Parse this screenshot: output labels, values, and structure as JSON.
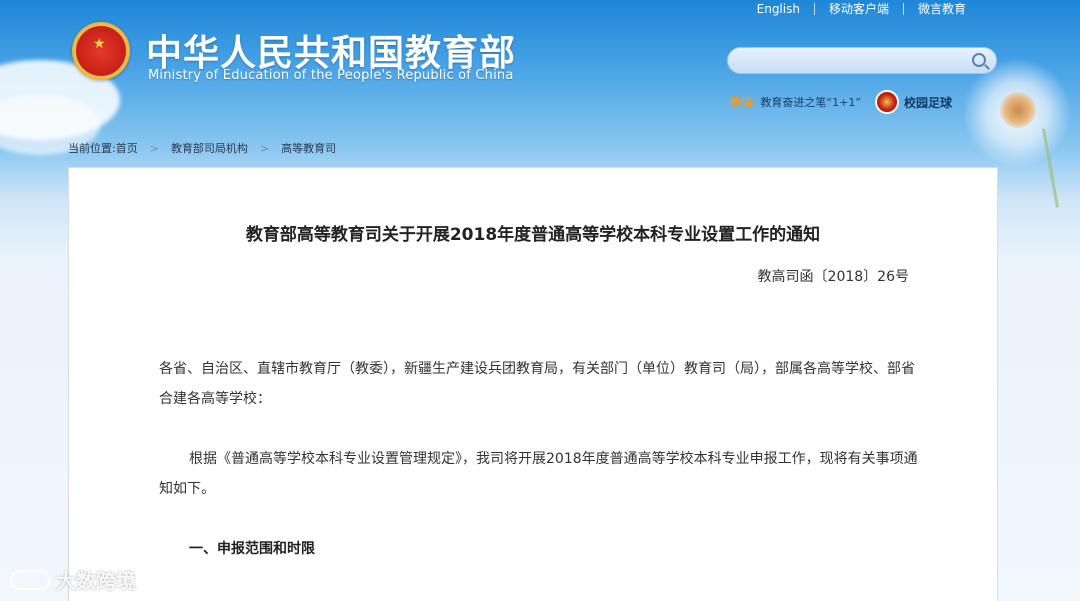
{
  "header": {
    "site_title": "中华人民共和国教育部",
    "site_subtitle": "Ministry of Education of the People's Republic of China",
    "top_links": [
      "English",
      "移动客户端",
      "微言教育"
    ],
    "search_placeholder": "",
    "hot_label": "热词:",
    "hot_link": "教育奋进之笔“1+1”",
    "campus_football": "校园足球"
  },
  "breadcrumb": {
    "prefix": "当前位置:",
    "items": [
      "首页",
      "教育部司局机构",
      "高等教育司"
    ],
    "separator": ">"
  },
  "article": {
    "title": "教育部高等教育司关于开展2018年度普通高等学校本科专业设置工作的通知",
    "doc_number": "教高司函〔2018〕26号",
    "paragraph1": "各省、自治区、直辖市教育厅（教委），新疆生产建设兵团教育局，有关部门（单位）教育司（局），部属各高等学校、部省合建各高等学校：",
    "paragraph2": "根据《普通高等学校本科专业设置管理规定》，我司将开展2018年度普通高等学校本科专业申报工作，现将有关事项通知如下。",
    "section1": "一、申报范围和时限"
  },
  "watermark": "大数跨境",
  "colors": {
    "header_blue": "#1f86d8",
    "hot_orange": "#f29c1f",
    "text": "#333333"
  }
}
